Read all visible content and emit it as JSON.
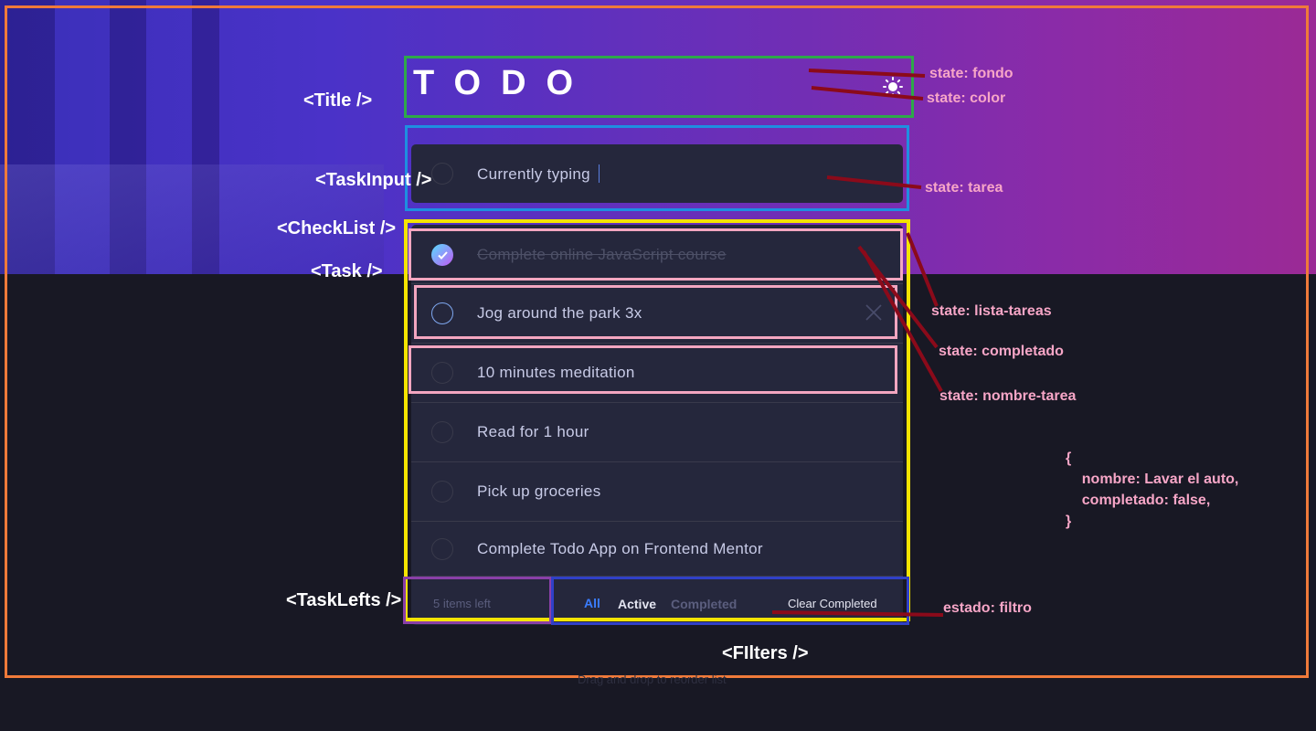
{
  "app": {
    "title": "TODO",
    "theme_toggle_icon": "sun-icon",
    "input": {
      "value": "Currently typing"
    },
    "tasks": [
      {
        "label": "Complete online JavaScript course",
        "completed": true
      },
      {
        "label": "Jog around the park 3x",
        "completed": false
      },
      {
        "label": "10 minutes meditation",
        "completed": false
      },
      {
        "label": "Read for 1 hour",
        "completed": false
      },
      {
        "label": "Pick up groceries",
        "completed": false
      },
      {
        "label": "Complete Todo App on Frontend Mentor",
        "completed": false
      }
    ],
    "footer": {
      "items_left": "5 items left",
      "filters": [
        "All",
        "Active",
        "Completed"
      ],
      "selected_filter": "All",
      "clear_label": "Clear Completed"
    },
    "hint": "Drag and drop to reorder list"
  },
  "annotations": {
    "components": {
      "title": "<Title />",
      "task_input": "<TaskInput />",
      "check_list": "<CheckList />",
      "task": "<Task />",
      "task_lefts": "<TaskLefts />",
      "filters": "<FIlters />"
    },
    "states": {
      "fondo": "state: fondo",
      "color": "state: color",
      "tarea": "state: tarea",
      "lista_tareas": "state: lista-tareas",
      "completado": "state: completado",
      "nombre_tarea": "state: nombre-tarea",
      "filtro": "estado: filtro"
    },
    "code": "{\n    nombre: Lavar el auto,\n    completado: false,\n}"
  },
  "colors": {
    "outer_frame": "#f07a3a",
    "title_box": "#2ea84a",
    "input_box": "#1e8fe0",
    "checklist_box": "#f5e400",
    "task_box": "#f3a6c0",
    "taskleft_box": "#8a3fa8",
    "filters_box": "#3040c8",
    "arrow": "#8b0a1a",
    "active_filter": "#3a7cfd"
  }
}
